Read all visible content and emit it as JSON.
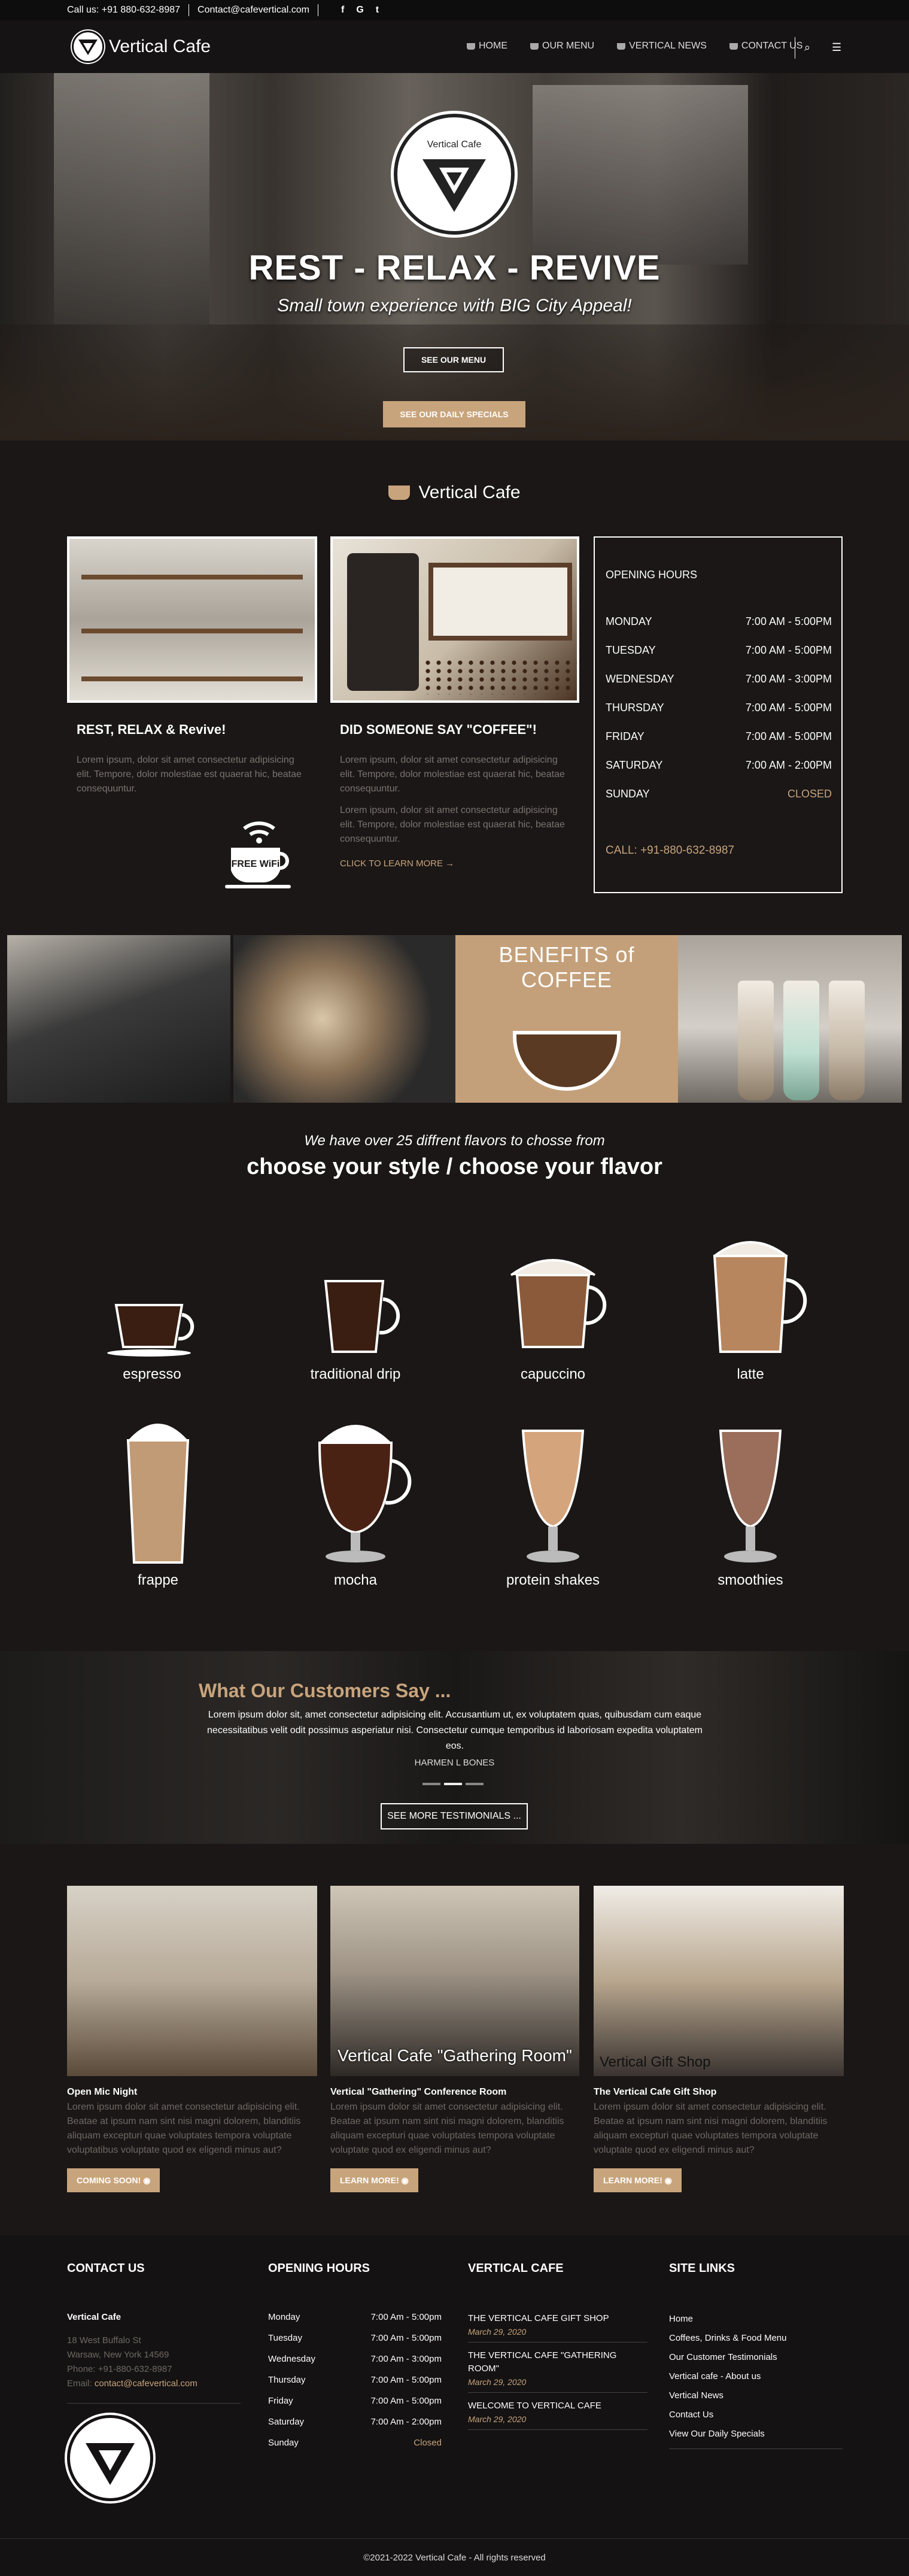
{
  "topbar": {
    "phone": "Call us: +91 880-632-8987",
    "email": "Contact@cafevertical.com",
    "social": [
      "f",
      "G",
      "t"
    ]
  },
  "nav": {
    "brand": "Vertical Cafe",
    "items": [
      "HOME",
      "OUR MENU",
      "VERTICAL NEWS",
      "CONTACT US"
    ]
  },
  "hero": {
    "badge": "Vertical Cafe",
    "title": "REST - RELAX - REVIVE",
    "subtitle": "Small town experience with BIG City Appeal!",
    "btn_menu": "SEE OUR MENU",
    "btn_specials": "SEE OUR DAILY SPECIALS"
  },
  "intro": {
    "title": "Vertical Cafe",
    "card1": {
      "heading": "REST, RELAX & Revive!",
      "text": "Lorem ipsum, dolor sit amet consectetur adipisicing elit. Tempore, dolor molestiae est quaerat hic, beatae consequuntur."
    },
    "card2": {
      "heading": "DID SOMEONE SAY \"COFFEE\"!",
      "text1": "Lorem ipsum, dolor sit amet consectetur adipisicing elit. Tempore, dolor molestiae est quaerat hic, beatae consequuntur.",
      "text2": "Lorem ipsum, dolor sit amet consectetur adipisicing elit. Tempore, dolor molestiae est quaerat hic, beatae consequuntur.",
      "link": "CLICK TO LEARN MORE →"
    },
    "wifi": "FREE WiFi",
    "hours": {
      "title": "OPENING HOURS",
      "rows": [
        [
          "MONDAY",
          "7:00 AM - 5:00PM"
        ],
        [
          "TUESDAY",
          "7:00 AM - 5:00PM"
        ],
        [
          "WEDNESDAY",
          "7:00 AM - 3:00PM"
        ],
        [
          "THURSDAY",
          "7:00 AM - 5:00PM"
        ],
        [
          "FRIDAY",
          "7:00 AM - 5:00PM"
        ],
        [
          "SATURDAY",
          "7:00 AM - 2:00PM"
        ],
        [
          "SUNDAY",
          "CLOSED"
        ]
      ],
      "call": "CALL: +91-880-632-8987"
    }
  },
  "gallery": {
    "benefits": "BENEFITS of COFFEE"
  },
  "flavors": {
    "sub": "We have over 25 diffrent flavors to chosse from",
    "heading": "choose your style / choose your flavor",
    "items": [
      "espresso",
      "traditional drip",
      "capuccino",
      "latte",
      "frappe",
      "mocha",
      "protein shakes",
      "smoothies"
    ]
  },
  "testimonials": {
    "heading": "What Our Customers Say ...",
    "quote": "Lorem ipsum dolor sit, amet consectetur adipisicing elit. Accusantium ut, ex voluptatem quas, quibusdam cum eaque necessitatibus velit odit possimus asperiatur nisi. Consectetur cumque temporibus id laboriosam expedita voluptatem eos.",
    "name": "HARMEN L BONES",
    "button": "SEE MORE TESTIMONIALS ..."
  },
  "events": [
    {
      "heading": "Open Mic Night",
      "text": "Lorem ipsum dolor sit amet consectetur adipisicing elit. Beatae at ipsum nam sint nisi magni dolorem, blanditiis aliquam excepturi quae voluptates tempora voluptate voluptatibus voluptate quod ex eligendi minus aut?",
      "button": "COMING SOON!"
    },
    {
      "heading": "Vertical \"Gathering\" Conference Room",
      "text": "Lorem ipsum dolor sit amet consectetur adipisicing elit. Beatae at ipsum nam sint nisi magni dolorem, blanditiis aliquam excepturi quae voluptates tempora voluptate voluptate quod ex eligendi minus aut?",
      "button": "LEARN MORE!",
      "caption": "Vertical Cafe \"Gathering Room\""
    },
    {
      "heading": "The Vertical Cafe Gift Shop",
      "text": "Lorem ipsum dolor sit amet consectetur adipisicing elit. Beatae at ipsum nam sint nisi magni dolorem, blanditiis aliquam excepturi quae voluptates tempora voluptate voluptate quod ex eligendi minus aut?",
      "button": "LEARN MORE!",
      "caption": "Vertical Gift Shop"
    }
  ],
  "footer": {
    "contact": {
      "title": "CONTACT US",
      "name": "Vertical Cafe",
      "addr1": "18 West Buffalo St",
      "addr2": "Warsaw, New York 14569",
      "phone": "Phone: +91-880-632-8987",
      "email_label": "Email:",
      "email": "contact@cafevertical.com"
    },
    "hours": {
      "title": "OPENING HOURS",
      "rows": [
        [
          "Monday",
          "7:00 Am - 5:00pm"
        ],
        [
          "Tuesday",
          "7:00 Am - 5:00pm"
        ],
        [
          "Wednesday",
          "7:00 Am - 3:00pm"
        ],
        [
          "Thursday",
          "7:00 Am - 5:00pm"
        ],
        [
          "Friday",
          "7:00 Am - 5:00pm"
        ],
        [
          "Saturday",
          "7:00 Am - 2:00pm"
        ],
        [
          "Sunday",
          "Closed"
        ]
      ]
    },
    "news": {
      "title": "VERTICAL CAFE",
      "items": [
        [
          "THE VERTICAL CAFE GIFT SHOP",
          "March 29, 2020"
        ],
        [
          "THE VERTICAL CAFE \"GATHERING ROOM\"",
          "March 29, 2020"
        ],
        [
          "WELCOME TO VERTICAL CAFE",
          "March 29, 2020"
        ]
      ]
    },
    "links": {
      "title": "SITE LINKS",
      "items": [
        "Home",
        "Coffees, Drinks & Food Menu",
        "Our Customer Testimonials",
        "Vertical cafe - About us",
        "Vertical News",
        "Contact Us",
        "View Our Daily Specials"
      ]
    },
    "copyright": "©2021-2022 Vertical Cafe - All rights reserved"
  },
  "colors": {
    "accent": "#c8a47c",
    "bg": "#1a1716"
  }
}
